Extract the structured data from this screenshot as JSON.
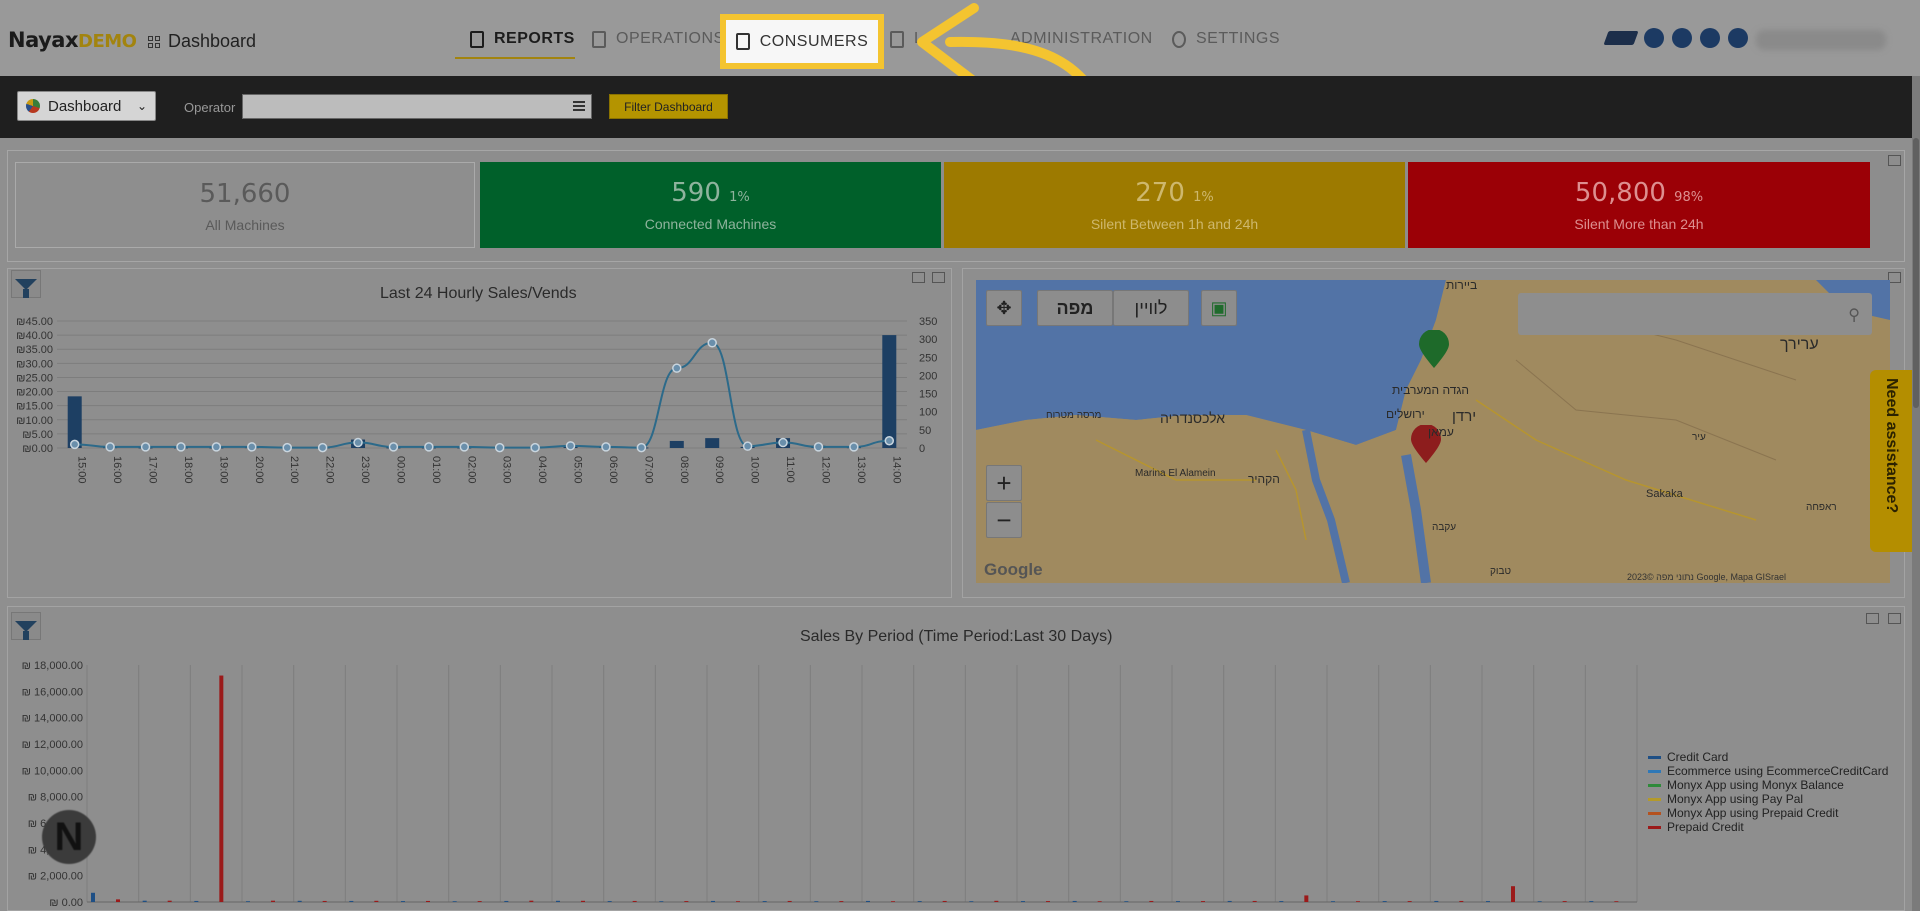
{
  "nav": {
    "brand": "Nayax",
    "brand_suffix": "DEMO",
    "crumb": "Dashboard",
    "items": [
      "REPORTS",
      "OPERATIONS",
      "CONSUMERS",
      "L",
      "ADMINISTRATION",
      "SETTINGS"
    ]
  },
  "filter": {
    "dashboard_select": "Dashboard",
    "operator_label": "Operator",
    "operator_value": "",
    "button": "Filter Dashboard"
  },
  "kpis": [
    {
      "value": "51,660",
      "pct": "",
      "label": "All Machines"
    },
    {
      "value": "590",
      "pct": "1%",
      "label": "Connected Machines"
    },
    {
      "value": "270",
      "pct": "1%",
      "label": "Silent Between 1h and 24h"
    },
    {
      "value": "50,800",
      "pct": "98%",
      "label": "Silent More than 24h"
    }
  ],
  "chart_data": [
    {
      "type": "bar",
      "title": "Last 24 Hourly Sales/Vends",
      "categories": [
        "15:00",
        "16:00",
        "17:00",
        "18:00",
        "19:00",
        "20:00",
        "21:00",
        "22:00",
        "23:00",
        "00:00",
        "01:00",
        "02:00",
        "03:00",
        "04:00",
        "05:00",
        "06:00",
        "07:00",
        "08:00",
        "09:00",
        "10:00",
        "11:00",
        "12:00",
        "13:00",
        "14:00"
      ],
      "y_ticks_left": [
        "₪0.00",
        "₪5.00",
        "₪10.00",
        "₪15.00",
        "₪20.00",
        "₪25.00",
        "₪30.00",
        "₪35.00",
        "₪40.00",
        "₪45.00"
      ],
      "y_ticks_right": [
        "0",
        "50",
        "100",
        "150",
        "200",
        "250",
        "300",
        "350"
      ],
      "ylim_left": [
        0,
        45
      ],
      "ylim_right": [
        0,
        350
      ],
      "series": [
        {
          "type": "bar",
          "values": [
            18.3,
            0.3,
            0.2,
            0.2,
            0.2,
            0.3,
            0.2,
            0.2,
            3.0,
            0.2,
            0.2,
            0.2,
            0.2,
            0.2,
            1.0,
            0.4,
            0.2,
            2.5,
            3.5,
            0.4,
            3.5,
            0.8,
            0.3,
            40.0
          ]
        },
        {
          "type": "line",
          "values": [
            10,
            3,
            3,
            3,
            3,
            3,
            1,
            1,
            15,
            3,
            3,
            3,
            1,
            1,
            6,
            3,
            1,
            220,
            290,
            5,
            15,
            3,
            3,
            20
          ]
        }
      ]
    },
    {
      "type": "bar",
      "title": "Sales By Period (Time Period:Last 30 Days)",
      "y_ticks": [
        "₪ 0.00",
        "₪ 2,000.00",
        "₪ 4,000.00",
        "₪ 6,000.00",
        "₪ 8,000.00",
        "₪ 10,000.00",
        "₪ 12,000.00",
        "₪ 14,000.00",
        "₪ 16,000.00",
        "₪ 18,000.00"
      ],
      "ylim": [
        0,
        18000
      ],
      "series": [
        {
          "name": "Credit Card",
          "color": "#1e4f85",
          "values": [
            700,
            100,
            80,
            60,
            90,
            80,
            70,
            60,
            80,
            90,
            70,
            60,
            80,
            70,
            60,
            80,
            70,
            60,
            70,
            80,
            60,
            70,
            80,
            70,
            60,
            70,
            80,
            70,
            60,
            70
          ]
        },
        {
          "name": "Ecommerce using EcommerceCreditCard",
          "color": "#2f78b7",
          "values": [
            0,
            0,
            0,
            0,
            0,
            0,
            0,
            0,
            0,
            0,
            0,
            0,
            0,
            0,
            0,
            0,
            0,
            0,
            0,
            0,
            0,
            0,
            0,
            0,
            0,
            0,
            0,
            0,
            0,
            0
          ]
        },
        {
          "name": "Monyx App using Monyx Balance",
          "color": "#2f8a3a",
          "values": [
            0,
            0,
            0,
            0,
            0,
            0,
            0,
            0,
            0,
            0,
            0,
            0,
            0,
            0,
            0,
            0,
            0,
            0,
            0,
            0,
            0,
            0,
            0,
            0,
            0,
            0,
            0,
            0,
            0,
            0
          ]
        },
        {
          "name": "Monyx App using Pay Pal",
          "color": "#b49a2a",
          "values": [
            0,
            0,
            0,
            0,
            0,
            0,
            0,
            0,
            0,
            0,
            0,
            0,
            0,
            0,
            0,
            0,
            0,
            0,
            0,
            0,
            0,
            0,
            0,
            0,
            0,
            0,
            0,
            0,
            0,
            0
          ]
        },
        {
          "name": "Monyx App using Prepaid Credit",
          "color": "#b5521f",
          "values": [
            0,
            0,
            0,
            0,
            0,
            0,
            0,
            0,
            0,
            0,
            0,
            0,
            0,
            0,
            0,
            0,
            0,
            0,
            0,
            0,
            0,
            0,
            0,
            0,
            0,
            0,
            0,
            0,
            0,
            0
          ]
        },
        {
          "name": "Prepaid Credit",
          "color": "#9b1a1a",
          "values": [
            200,
            100,
            17200,
            100,
            80,
            90,
            80,
            70,
            100,
            90,
            80,
            70,
            60,
            80,
            70,
            60,
            80,
            90,
            70,
            60,
            80,
            70,
            80,
            500,
            60,
            70,
            80,
            1200,
            70,
            60
          ]
        }
      ]
    }
  ],
  "map": {
    "controls": {
      "map_btn": "מפה",
      "sat_btn": "לוויין"
    },
    "labels": [
      "ביירות",
      "ערירך",
      "הגדה המערבית",
      "ירושלים",
      "עמאן",
      "ירדן",
      "אלכסנדריה",
      "הקהיר",
      "מרסה מטרוח",
      "Marina El Alamein",
      "Sakaka",
      "עקבה",
      "טבוק",
      "ראפחה",
      "עיר"
    ],
    "copyright": "נתוני מפה ©2023 Google, Mapa GISrael",
    "google": "Google"
  },
  "help": {
    "label": "Need assistance?"
  }
}
